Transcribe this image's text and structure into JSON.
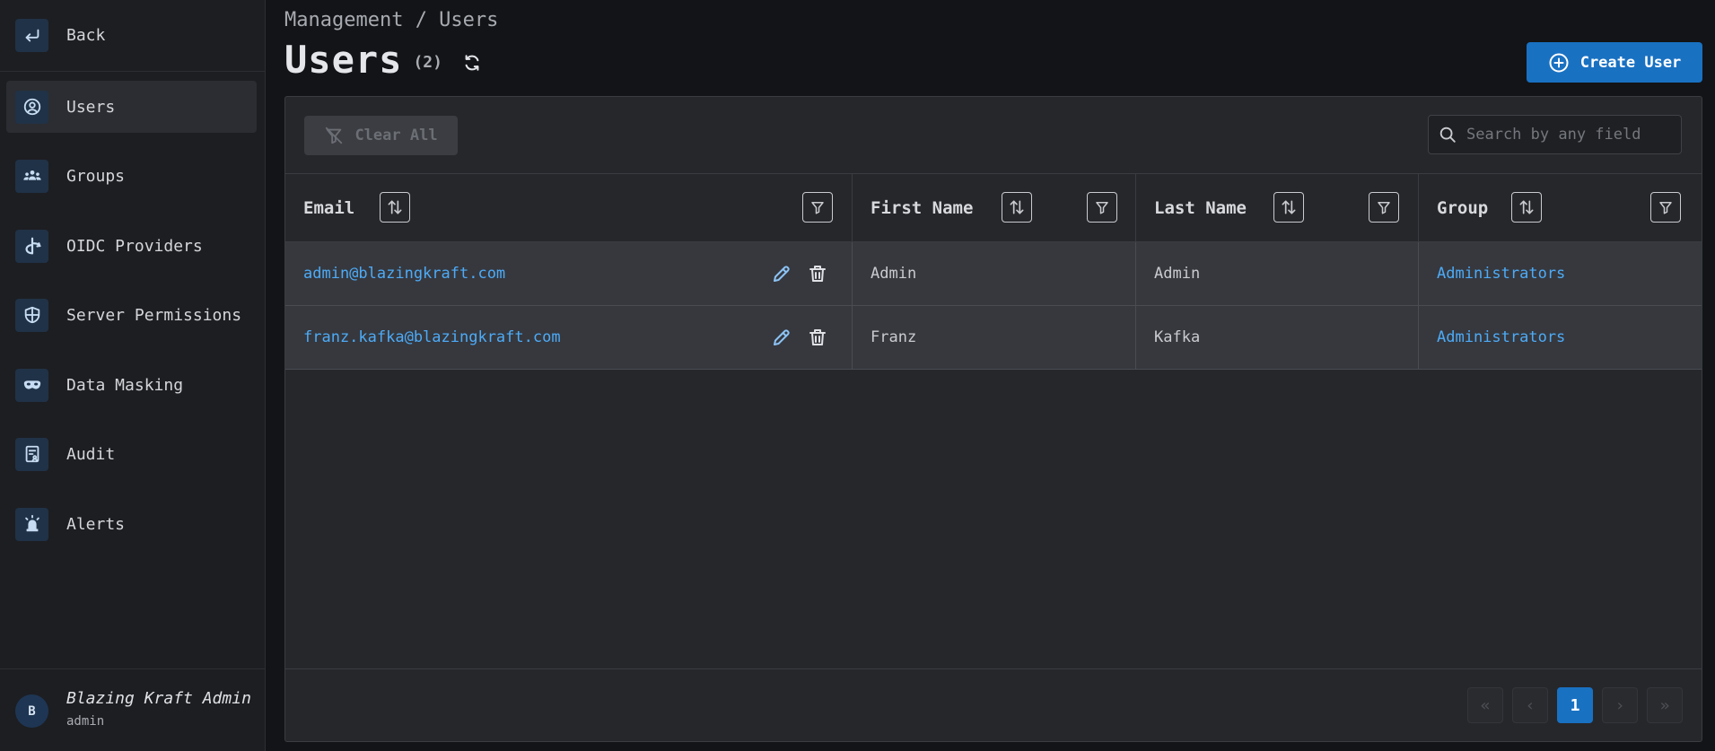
{
  "sidebar": {
    "back_label": "Back",
    "items": [
      {
        "label": "Users",
        "icon": "user-circle-icon",
        "active": true
      },
      {
        "label": "Groups",
        "icon": "groups-icon"
      },
      {
        "label": "OIDC Providers",
        "icon": "oidc-icon"
      },
      {
        "label": "Server Permissions",
        "icon": "shield-icon"
      },
      {
        "label": "Data Masking",
        "icon": "mask-icon"
      },
      {
        "label": "Audit",
        "icon": "audit-icon"
      },
      {
        "label": "Alerts",
        "icon": "alarm-icon"
      }
    ],
    "user": {
      "initial": "B",
      "name": "Blazing Kraft Admin",
      "role": "admin"
    }
  },
  "header": {
    "breadcrumb": "Management / Users",
    "title": "Users",
    "count": "(2)",
    "create_label": "Create User"
  },
  "toolbar": {
    "clear_label": "Clear All",
    "search_placeholder": "Search by any field"
  },
  "table": {
    "columns": [
      "Email",
      "First Name",
      "Last Name",
      "Group"
    ],
    "rows": [
      {
        "email": "admin@blazingkraft.com",
        "first_name": "Admin",
        "last_name": "Admin",
        "group": "Administrators"
      },
      {
        "email": "franz.kafka@blazingkraft.com",
        "first_name": "Franz",
        "last_name": "Kafka",
        "group": "Administrators"
      }
    ]
  },
  "pagination": {
    "current": "1",
    "first": "«",
    "prev": "‹",
    "next": "›",
    "last": "»"
  },
  "colors": {
    "accent": "#1971c2",
    "link": "#4dabf7",
    "sidebar_bg": "#1d1e22",
    "page_bg": "#131417"
  }
}
